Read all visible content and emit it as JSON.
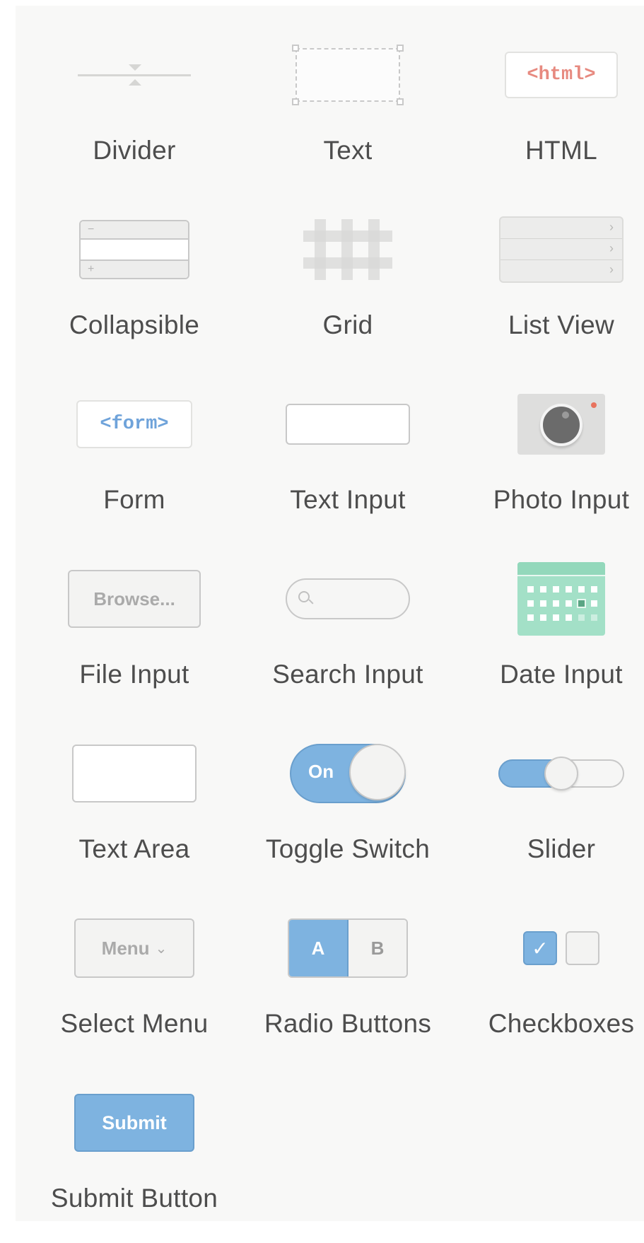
{
  "colors": {
    "panel_background": "#f8f8f7",
    "label_text": "#4d4d4d",
    "accent_blue": "#7eb3e0",
    "html_red": "#e78a80",
    "form_blue": "#6fa3da",
    "date_green": "#a3e0c7",
    "photo_dot": "#e8735e"
  },
  "components": [
    {
      "label": "Divider",
      "icon": "divider-icon"
    },
    {
      "label": "Text",
      "icon": "text-box-icon"
    },
    {
      "label": "HTML",
      "icon": "html-tag-icon",
      "icon_text": "<html>"
    },
    {
      "label": "Collapsible",
      "icon": "collapsible-icon",
      "collapse_symbol": "−",
      "expand_symbol": "+"
    },
    {
      "label": "Grid",
      "icon": "grid-icon"
    },
    {
      "label": "List View",
      "icon": "list-view-icon"
    },
    {
      "label": "Form",
      "icon": "form-tag-icon",
      "icon_text": "<form>"
    },
    {
      "label": "Text Input",
      "icon": "text-input-icon"
    },
    {
      "label": "Photo Input",
      "icon": "camera-icon"
    },
    {
      "label": "File Input",
      "icon": "browse-button-icon",
      "icon_text": "Browse..."
    },
    {
      "label": "Search Input",
      "icon": "search-field-icon"
    },
    {
      "label": "Date Input",
      "icon": "calendar-icon"
    },
    {
      "label": "Text Area",
      "icon": "text-area-icon"
    },
    {
      "label": "Toggle Switch",
      "icon": "toggle-icon",
      "icon_text": "On"
    },
    {
      "label": "Slider",
      "icon": "slider-icon",
      "value": 0.5
    },
    {
      "label": "Select Menu",
      "icon": "select-menu-icon",
      "icon_text": "Menu"
    },
    {
      "label": "Radio Buttons",
      "icon": "radio-buttons-icon",
      "option_a": "A",
      "option_b": "B"
    },
    {
      "label": "Checkboxes",
      "icon": "checkboxes-icon"
    },
    {
      "label": "Submit Button",
      "icon": "submit-button-icon",
      "icon_text": "Submit"
    }
  ]
}
